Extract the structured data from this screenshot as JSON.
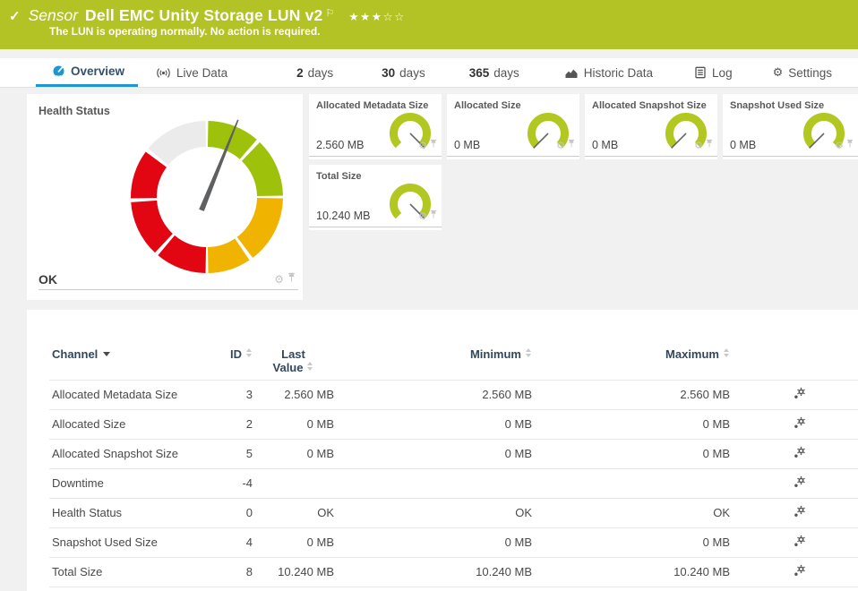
{
  "colors": {
    "banner_green": "#b3c224",
    "gauge_green": "#9ec10c",
    "gauge_yellow": "#f0b400",
    "gauge_red": "#e20512",
    "gauge_unused": "#ebebeb",
    "mini_gauge_green": "#b2c71f",
    "active_tab_blue": "#2095ce"
  },
  "icons": {
    "check": "✓",
    "flag": "⚐",
    "stars": "★★★☆☆",
    "gear": "⚙"
  },
  "banner": {
    "kind": "Sensor",
    "title": "Dell EMC Unity Storage LUN v2",
    "message": "The LUN is operating normally. No action is required."
  },
  "tabs": [
    {
      "label": "Overview",
      "active": true
    },
    {
      "label": "Live Data"
    },
    {
      "num": "2",
      "label": "days"
    },
    {
      "num": "30",
      "label": "days"
    },
    {
      "num": "365",
      "label": "days"
    },
    {
      "label": "Historic Data"
    },
    {
      "label": "Log"
    },
    {
      "label": "Settings"
    }
  ],
  "health": {
    "title": "Health Status",
    "status": "OK",
    "needle_deg": 22
  },
  "gauges": [
    {
      "title": "Allocated Metadata Size",
      "value": "2.560 MB",
      "level": "max"
    },
    {
      "title": "Allocated Size",
      "value": "0 MB",
      "level": "min"
    },
    {
      "title": "Allocated Snapshot Size",
      "value": "0 MB",
      "level": "min"
    },
    {
      "title": "Snapshot Used Size",
      "value": "0 MB",
      "level": "min"
    },
    {
      "title": "Total Size",
      "value": "10.240 MB",
      "level": "max"
    }
  ],
  "table": {
    "headers": {
      "channel": "Channel",
      "id": "ID",
      "last": "Last Value",
      "min": "Minimum",
      "max": "Maximum"
    },
    "rows": [
      {
        "channel": "Allocated Metadata Size",
        "id": "3",
        "last": "2.560 MB",
        "min": "2.560 MB",
        "max": "2.560 MB"
      },
      {
        "channel": "Allocated Size",
        "id": "2",
        "last": "0 MB",
        "min": "0 MB",
        "max": "0 MB"
      },
      {
        "channel": "Allocated Snapshot Size",
        "id": "5",
        "last": "0 MB",
        "min": "0 MB",
        "max": "0 MB"
      },
      {
        "channel": "Downtime",
        "id": "-4",
        "last": "",
        "min": "",
        "max": ""
      },
      {
        "channel": "Health Status",
        "id": "0",
        "last": "OK",
        "min": "OK",
        "max": "OK"
      },
      {
        "channel": "Snapshot Used Size",
        "id": "4",
        "last": "0 MB",
        "min": "0 MB",
        "max": "0 MB"
      },
      {
        "channel": "Total Size",
        "id": "8",
        "last": "10.240 MB",
        "min": "10.240 MB",
        "max": "10.240 MB"
      }
    ]
  }
}
